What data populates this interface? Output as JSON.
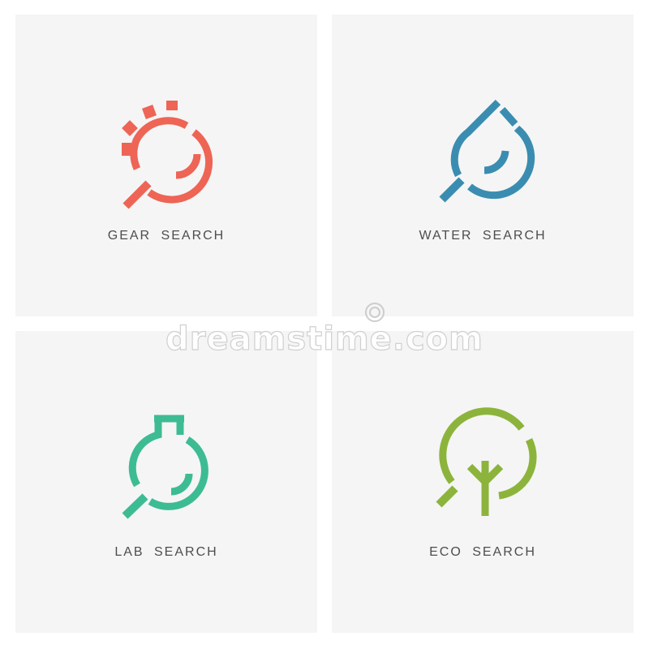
{
  "logos": [
    {
      "caption": "GEAR SEARCH",
      "icon": "gear-search-icon",
      "color": "#ee6455"
    },
    {
      "caption": "WATER SEARCH",
      "icon": "water-drop-search-icon",
      "color": "#3a8db0"
    },
    {
      "caption": "LAB SEARCH",
      "icon": "lab-flask-search-icon",
      "color": "#3dbc93"
    },
    {
      "caption": "ECO SEARCH",
      "icon": "eco-tree-search-icon",
      "color": "#8cb43c"
    }
  ],
  "watermark": {
    "text": "dreamstime.com",
    "icon": "dreamstime-logo-icon"
  }
}
